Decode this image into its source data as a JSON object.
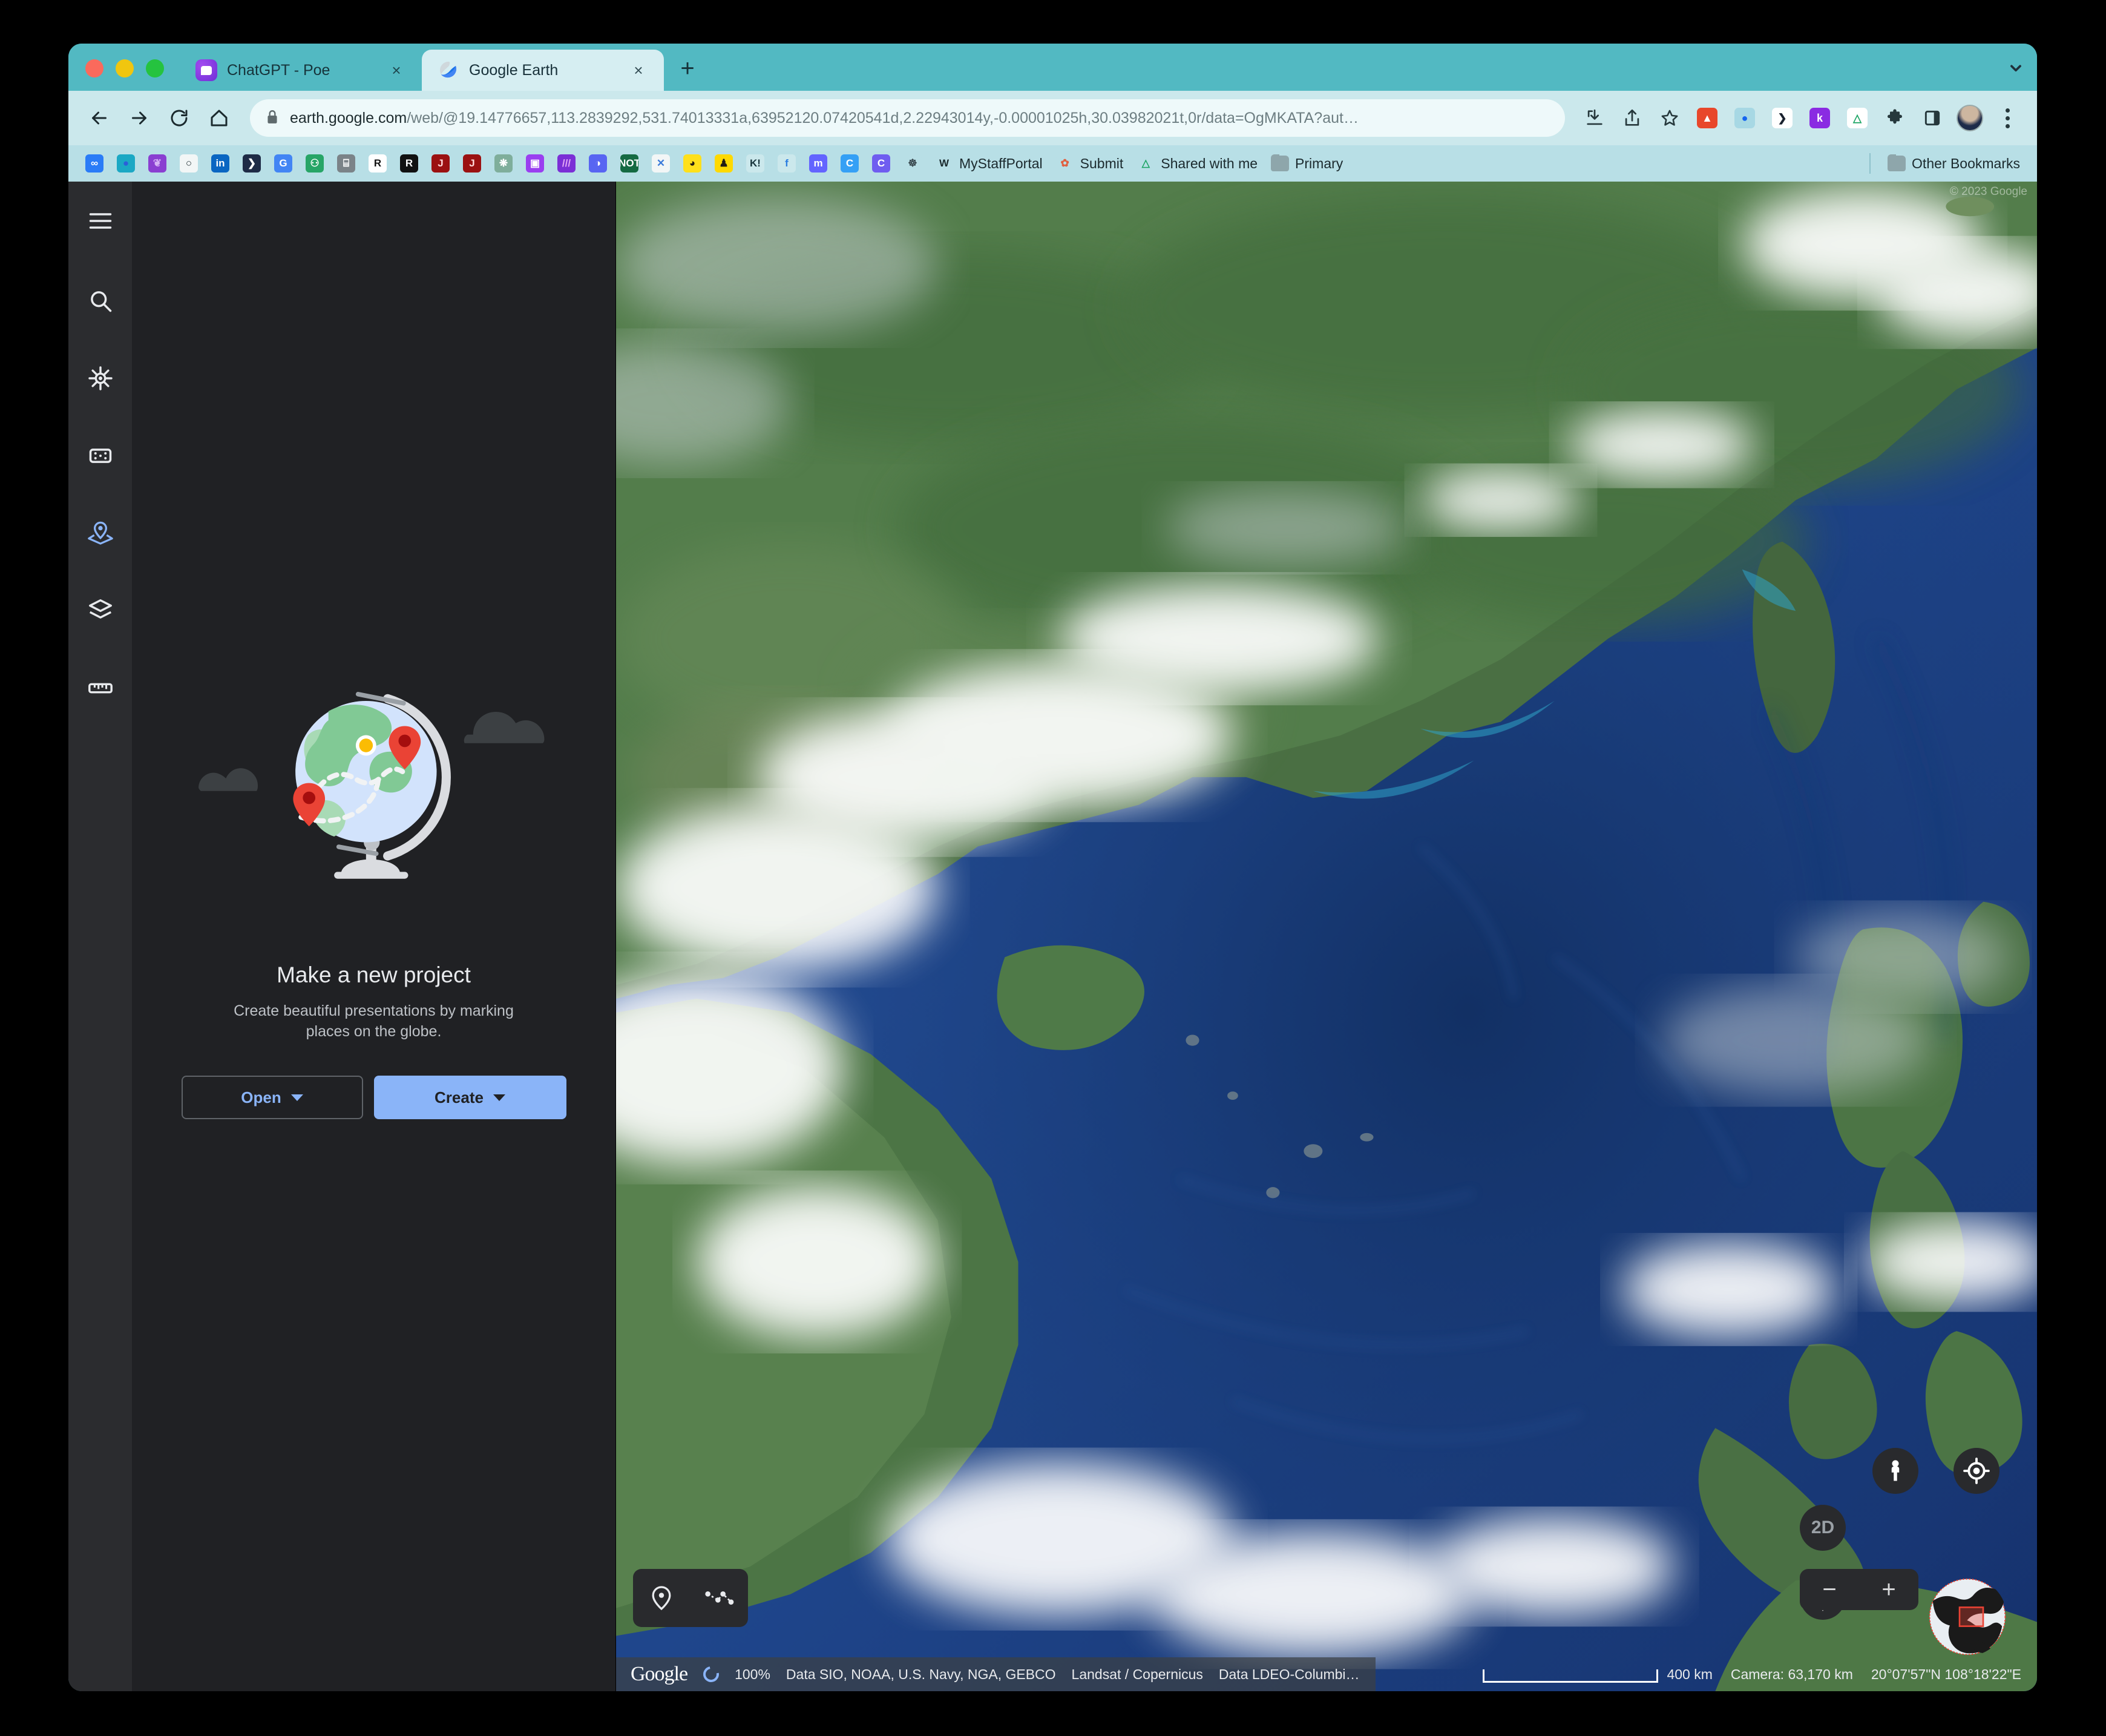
{
  "browser": {
    "tabs": [
      {
        "title": "ChatGPT - Poe",
        "favicon": "poe-icon",
        "active": false,
        "close_label": "×"
      },
      {
        "title": "Google Earth",
        "favicon": "google-earth-icon",
        "active": true,
        "close_label": "×"
      }
    ],
    "new_tab_label": "+",
    "toolbar": {
      "back_icon": "back-arrow-icon",
      "forward_icon": "forward-arrow-icon",
      "reload_icon": "reload-icon",
      "home_icon": "home-icon",
      "lock_icon": "lock-icon",
      "url_domain": "earth.google.com",
      "url_path": "/web/@19.14776657,113.2839292,531.74013331a,63952120.07420541d,2.22943014y,-0.00001025h,30.03982021t,0r/data=OgMKATA?aut…",
      "download_icon": "download-icon",
      "share_icon": "share-icon",
      "bookmark_star_icon": "star-icon",
      "profile_icon": "profile-avatar",
      "menu_icon": "kebab-menu-icon"
    },
    "extensions": [
      {
        "name": "fireshot-extension",
        "glyph": "▲",
        "bg": "#e8472b",
        "fg": "#ffffff"
      },
      {
        "name": "blue-dot-extension",
        "glyph": "●",
        "bg": "#a7d8e4",
        "fg": "#1565f0"
      },
      {
        "name": "dashlane-extension",
        "glyph": "⌫",
        "bg": "#ffffff",
        "fg": "#19212e"
      },
      {
        "name": "kobo-extension",
        "glyph": "k",
        "bg": "#8a2be2",
        "fg": "#ffffff"
      },
      {
        "name": "google-drive-extension",
        "glyph": "△",
        "bg": "#ffffff",
        "fg": "#1aa463"
      },
      {
        "name": "puzzle-extensions-icon",
        "glyph": "❖",
        "bg": "#cbe8ec",
        "fg": "#26383c"
      },
      {
        "name": "side-panel-icon",
        "glyph": "▭",
        "bg": "#cbe8ec",
        "fg": "#26383c"
      }
    ],
    "bookmarks": [
      {
        "label": "",
        "name": "infinity-bookmark",
        "glyph": "∞",
        "bg": "#2a7cf7",
        "fg": "#ffffff"
      },
      {
        "label": "",
        "name": "eggs-bookmark",
        "glyph": "●",
        "bg": "#1ba8c4",
        "fg": "#2b5fd9"
      },
      {
        "label": "",
        "name": "feather-bookmark",
        "glyph": "❦",
        "bg": "#8a3fd1",
        "fg": "#d6b3f5"
      },
      {
        "label": "",
        "name": "github-bookmark",
        "glyph": "○",
        "bg": "#f2f6f6",
        "fg": "#1b2a2e"
      },
      {
        "label": "",
        "name": "linkedin-bookmark",
        "glyph": "in",
        "bg": "#0a66c2",
        "fg": "#ffffff"
      },
      {
        "label": "",
        "name": "prezi-bookmark",
        "glyph": "❯",
        "bg": "#1e2b46",
        "fg": "#ffffff"
      },
      {
        "label": "",
        "name": "google-translate-bookmark",
        "glyph": "G",
        "bg": "#4285f4",
        "fg": "#ffffff"
      },
      {
        "label": "",
        "name": "robot-bookmark",
        "glyph": "⚇",
        "bg": "#27a567",
        "fg": "#ffffff"
      },
      {
        "label": "",
        "name": "slides-bookmark",
        "glyph": "⌸",
        "bg": "#7b8388",
        "fg": "#ffffff"
      },
      {
        "label": "",
        "name": "researchgate-bookmark",
        "glyph": "R",
        "bg": "#ffffff",
        "fg": "#111111"
      },
      {
        "label": "",
        "name": "rstudio-bookmark",
        "glyph": "R",
        "bg": "#111111",
        "fg": "#ffffff"
      },
      {
        "label": "",
        "name": "jstor-bookmark",
        "glyph": "J",
        "bg": "#9b1111",
        "fg": "#ffd9d9"
      },
      {
        "label": "",
        "name": "jstor-2-bookmark",
        "glyph": "J",
        "bg": "#9b1111",
        "fg": "#ffd9d9"
      },
      {
        "label": "",
        "name": "openai-bookmark",
        "glyph": "❋",
        "bg": "#7fae9b",
        "fg": "#ffffff"
      },
      {
        "label": "",
        "name": "poe-bookmark",
        "glyph": "▣",
        "bg": "#9a3ef0",
        "fg": "#ffffff"
      },
      {
        "label": "",
        "name": "books-bookmark",
        "glyph": "///",
        "bg": "#7b2fd6",
        "fg": "#e3a7f5"
      },
      {
        "label": "",
        "name": "discord-bookmark",
        "glyph": "◑",
        "bg": "#5865f2",
        "fg": "#ffffff"
      },
      {
        "label": "",
        "name": "notion-bookmark",
        "glyph": "NOT",
        "bg": "#156a42",
        "fg": "#ffffff"
      },
      {
        "label": "",
        "name": "x-bookmark",
        "glyph": "✕",
        "bg": "#f2f6f6",
        "fg": "#3a7ad9"
      },
      {
        "label": "",
        "name": "mailchimp-bookmark",
        "glyph": "◕",
        "bg": "#ffe01b",
        "fg": "#241c15"
      },
      {
        "label": "",
        "name": "yellow-bookmark",
        "glyph": "♟",
        "bg": "#ffd900",
        "fg": "#241c15"
      },
      {
        "label": "",
        "name": "kahoot-bookmark",
        "glyph": "K!",
        "bg": "#cbe8ec",
        "fg": "#16333a"
      },
      {
        "label": "",
        "name": "flickr-bookmark",
        "glyph": "f",
        "bg": "#cbe8ec",
        "fg": "#2b7de0"
      },
      {
        "label": "",
        "name": "mastodon-bookmark",
        "glyph": "m",
        "bg": "#6364ff",
        "fg": "#ffffff"
      },
      {
        "label": "",
        "name": "coursera-bookmark",
        "glyph": "C",
        "bg": "#35a0f5",
        "fg": "#ffffff"
      },
      {
        "label": "",
        "name": "coursera-2-bookmark",
        "glyph": "C",
        "bg": "#6f5df0",
        "fg": "#ffffff"
      },
      {
        "label": "",
        "name": "molecule-bookmark",
        "glyph": "☸",
        "bg": "#b8dfe6",
        "fg": "#3a4a50"
      },
      {
        "label": "MyStaffPortal",
        "name": "mystaffportal-bookmark",
        "glyph": "W",
        "bg": "#b8dfe6",
        "fg": "#1b2a2e"
      },
      {
        "label": "Submit",
        "name": "submit-bookmark",
        "glyph": "✿",
        "bg": "#b8dfe6",
        "fg": "#e06040"
      },
      {
        "label": "Shared with me",
        "name": "shared-with-me-bookmark",
        "glyph": "△",
        "bg": "#b8dfe6",
        "fg": "#1aa463"
      },
      {
        "label": "Primary",
        "name": "primary-folder-bookmark",
        "glyph": "folder",
        "bg": "#b8dfe6",
        "fg": "#8ea6ab"
      }
    ],
    "other_bookmarks_label": "Other Bookmarks"
  },
  "earth": {
    "rail": [
      {
        "name": "menu-icon",
        "label": "Menu",
        "active": false
      },
      {
        "name": "search-icon",
        "label": "Search",
        "active": false
      },
      {
        "name": "voyager-icon",
        "label": "Voyager",
        "active": false
      },
      {
        "name": "feeling-lucky-icon",
        "label": "I'm Feeling Lucky",
        "active": false
      },
      {
        "name": "projects-icon",
        "label": "Projects",
        "active": true
      },
      {
        "name": "layers-icon",
        "label": "Map Style",
        "active": false
      },
      {
        "name": "measure-icon",
        "label": "Measure distance and area",
        "active": false
      }
    ],
    "panel": {
      "illustration": "globe-with-pins-illustration",
      "title": "Make a new project",
      "subtitle": "Create beautiful presentations by marking places on the globe.",
      "open_button": "Open",
      "create_button": "Create"
    },
    "map_controls": {
      "place_marker_label": "place-marker-icon",
      "draw_path_label": "draw-line-icon",
      "pegman_label": "pegman-street-view-icon",
      "locate_label": "my-location-icon",
      "view_mode_label": "2D",
      "compass_label": "compass-icon",
      "zoom_out_label": "−",
      "zoom_in_label": "+",
      "mini_globe_label": "mini-globe-overview"
    },
    "status": {
      "brand": "Google",
      "loading_percent": "100%",
      "attribution_1": "Data SIO, NOAA, U.S. Navy, NGA, GEBCO",
      "attribution_2": "Landsat / Copernicus",
      "attribution_3": "Data LDEO-Columbi…",
      "scale_label": "400 km",
      "camera": "Camera: 63,170 km",
      "coordinates": "20°07'57\"N 108°18'22\"E"
    },
    "map_copyright": "© 2023 Google"
  },
  "colors": {
    "browser_chrome": "#52b9c2",
    "toolbar": "#cbe8ec",
    "bookmarks_bar": "#b8dfe6",
    "panel_bg": "#202124",
    "rail_bg": "#2b2c2f",
    "accent_blue": "#8ab4f8",
    "ocean": "#20488f",
    "land": "#4e7a4a"
  }
}
